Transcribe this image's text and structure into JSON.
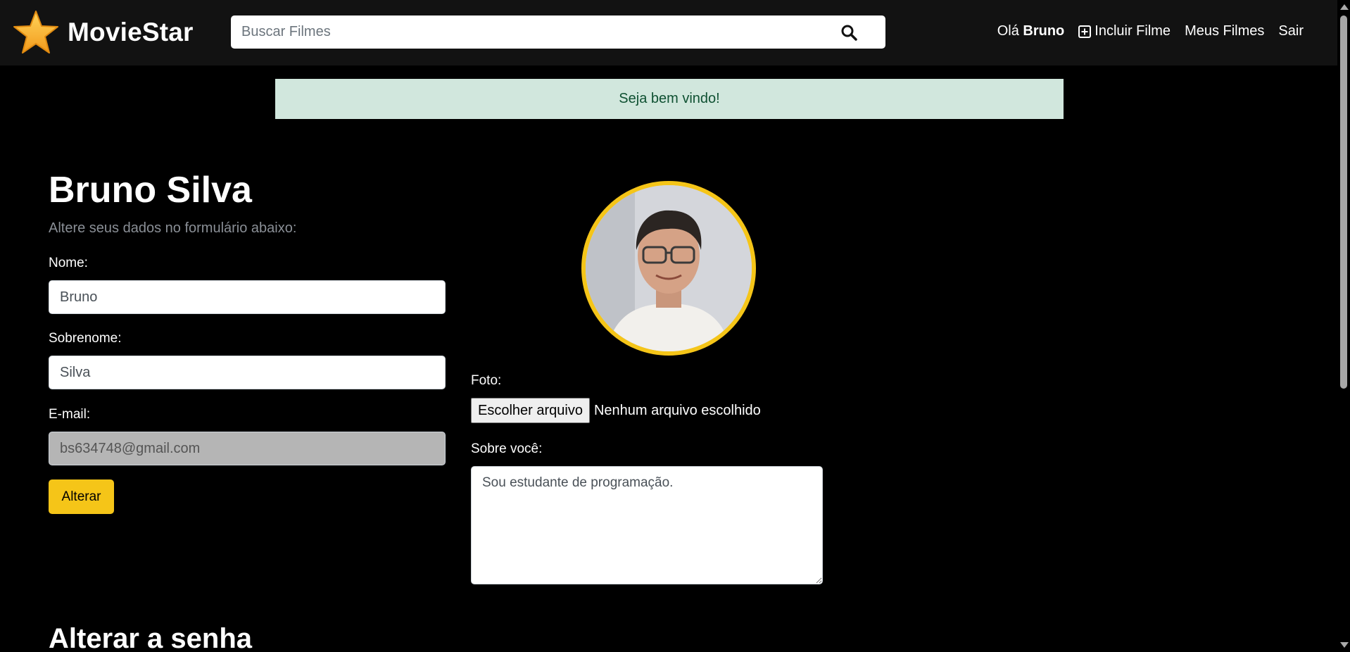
{
  "header": {
    "brand": "MovieStar",
    "search_placeholder": "Buscar Filmes",
    "greeting": "Olá",
    "user_name": "Bruno",
    "add_movie": "Incluir Filme",
    "my_movies": "Meus Filmes",
    "logout": "Sair"
  },
  "alert": {
    "message": "Seja bem vindo!"
  },
  "profile": {
    "title": "Bruno Silva",
    "subtitle": "Altere seus dados no formulário abaixo:",
    "name_label": "Nome:",
    "name_value": "Bruno",
    "lastname_label": "Sobrenome:",
    "lastname_value": "Silva",
    "email_label": "E-mail:",
    "email_value": "bs634748@gmail.com",
    "submit_label": "Alterar",
    "photo_label": "Foto:",
    "file_button": "Escolher arquivo",
    "file_status": "Nenhum arquivo escolhido",
    "bio_label": "Sobre você:",
    "bio_value": "Sou estudante de programação."
  },
  "password_section": {
    "title": "Alterar a senha"
  },
  "colors": {
    "accent": "#f5c518",
    "header_bg": "#121212",
    "page_bg": "#000000",
    "alert_bg": "#d1e7dd",
    "alert_text": "#0f5132"
  }
}
